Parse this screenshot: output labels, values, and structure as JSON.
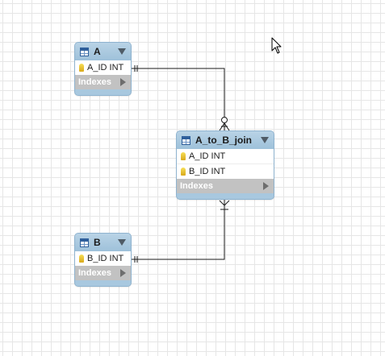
{
  "diagram": {
    "tables": [
      {
        "name": "A",
        "columns": [
          {
            "label": "A_ID INT"
          }
        ],
        "indexes_label": "Indexes"
      },
      {
        "name": "A_to_B_join",
        "columns": [
          {
            "label": "A_ID INT"
          },
          {
            "label": "B_ID INT"
          }
        ],
        "indexes_label": "Indexes"
      },
      {
        "name": "B",
        "columns": [
          {
            "label": "B_ID INT"
          }
        ],
        "indexes_label": "Indexes"
      }
    ],
    "relationships": [
      {
        "from": "A",
        "to": "A_to_B_join",
        "from_cardinality": "exactly-one",
        "to_cardinality": "zero-or-many"
      },
      {
        "from": "B",
        "to": "A_to_B_join",
        "from_cardinality": "exactly-one",
        "to_cardinality": "one-or-many"
      }
    ]
  },
  "colors": {
    "header": "#a8c8df",
    "grid": "#e6e6e6",
    "indexes_bar": "#c2c2c2",
    "connector": "#1a1a1a",
    "key": "#e8c33a"
  }
}
